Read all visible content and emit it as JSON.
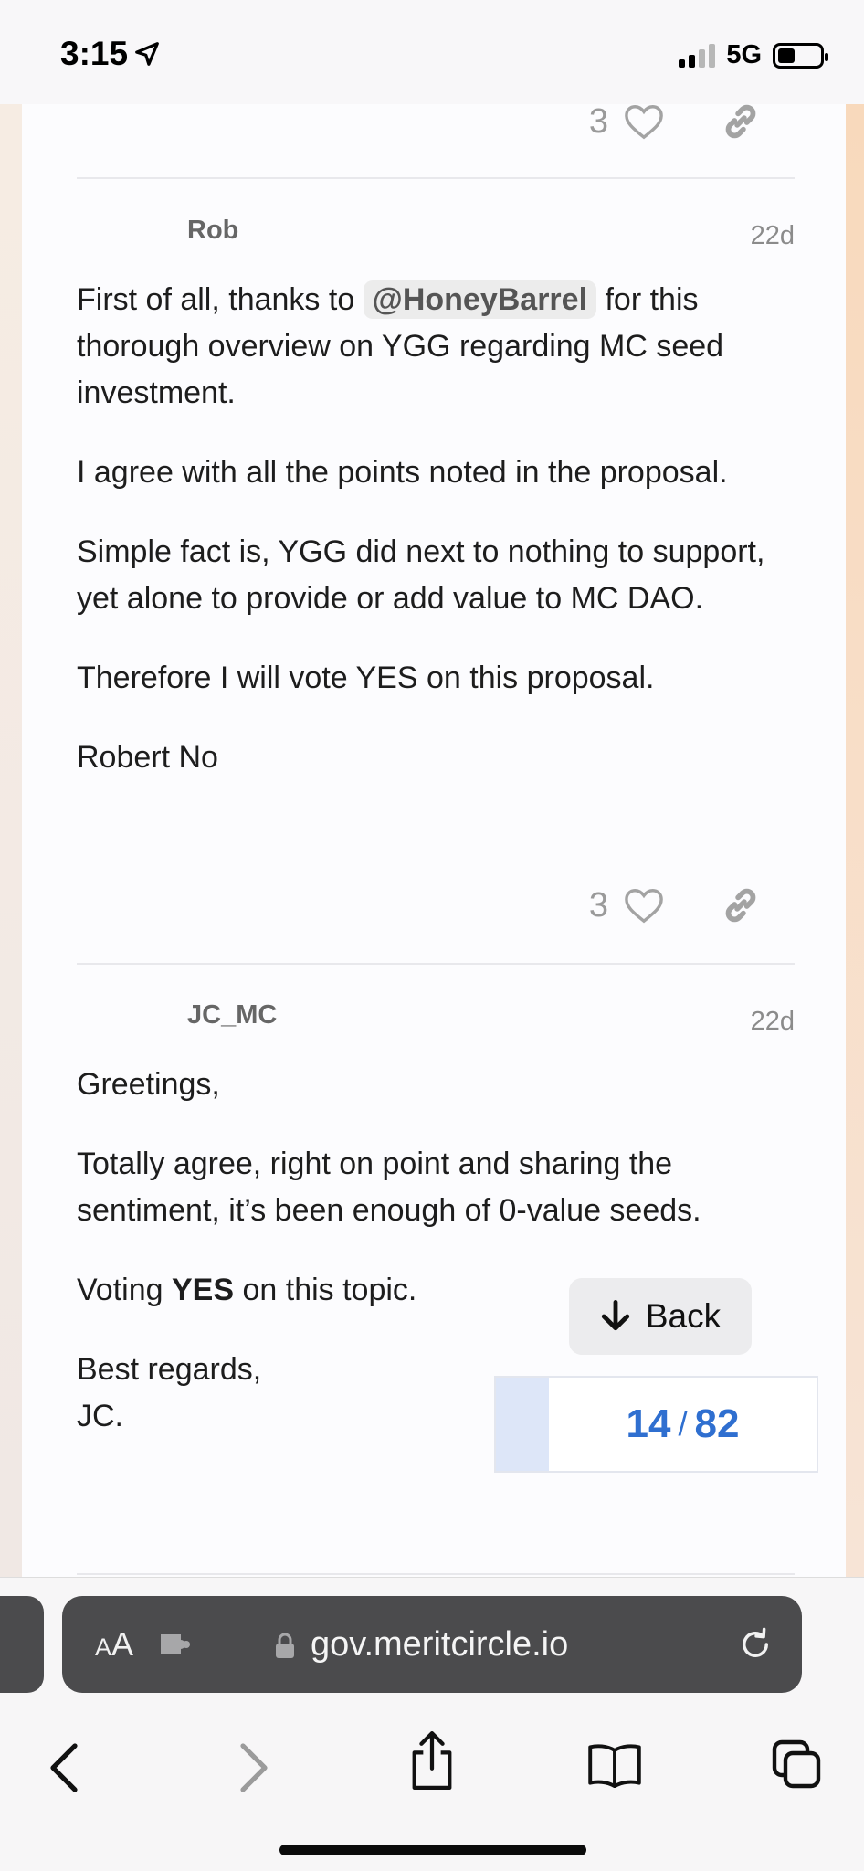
{
  "status_bar": {
    "time": "3:15",
    "network": "5G"
  },
  "posts": [
    {
      "likes": "3"
    },
    {
      "author": "Rob",
      "age": "22d",
      "body": {
        "p1_before": "First of all, thanks to ",
        "p1_mention": "@HoneyBarrel",
        "p1_after": " for this thorough overview on YGG regarding MC seed investment.",
        "p2": "I agree with all the points noted in the proposal.",
        "p3": "Simple fact is, YGG did next to nothing to support, yet alone to provide or add value to MC DAO.",
        "p4": "Therefore I will vote YES on this proposal.",
        "p5": "Robert No"
      },
      "likes": "3"
    },
    {
      "author": "JC_MC",
      "age": "22d",
      "body": {
        "p1": "Greetings,",
        "p2": "Totally agree, right on point and sharing the sentiment, it’s been enough of 0-value seeds.",
        "p3_before": "Voting ",
        "p3_bold": "YES",
        "p3_after": " on this topic.",
        "p4_line1": "Best regards,",
        "p4_line2": "JC."
      }
    }
  ],
  "back_button": {
    "label": "Back"
  },
  "progress": {
    "current": "14",
    "separator": "/",
    "total": "82"
  },
  "browser": {
    "aa_label_small": "A",
    "aa_label": "A",
    "url": "gov.meritcircle.io"
  },
  "icons": {
    "heart": "heart-icon",
    "link": "link-icon",
    "arrow_down": "arrow-down-icon",
    "lock": "lock-icon",
    "reload": "reload-icon",
    "back": "chevron-left-icon",
    "forward": "chevron-right-icon",
    "share": "share-icon",
    "bookmarks": "book-icon",
    "tabs": "tabs-icon"
  },
  "colors": {
    "accent": "#2f6fd0",
    "url_bar": "#4b4b4d"
  }
}
